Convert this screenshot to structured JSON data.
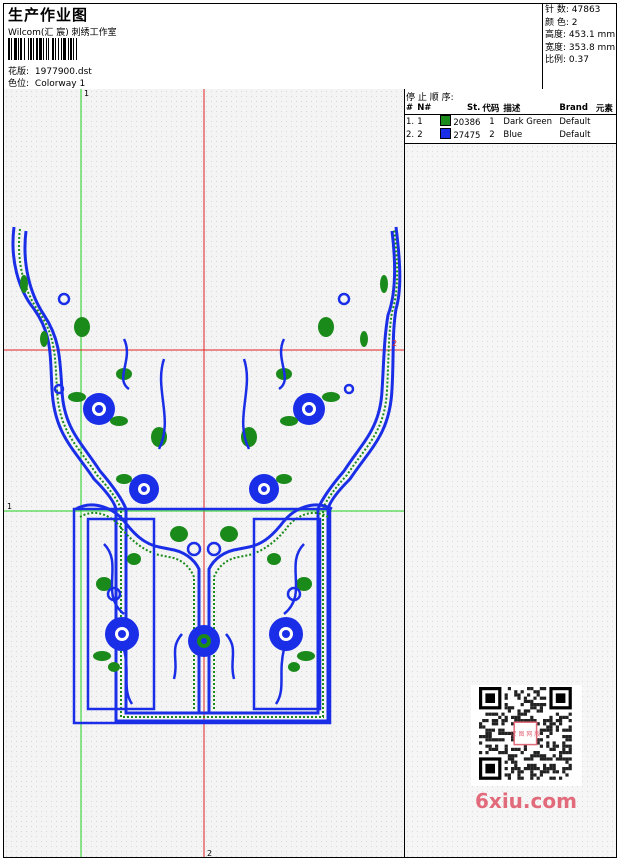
{
  "header": {
    "title": "生产作业图",
    "company": "Wilcom(汇 宸) 刺绣工作室",
    "design_label": "花版:",
    "design_value": "1977900.dst",
    "colorway_label": "色位:",
    "colorway_value": "Colorway 1"
  },
  "stats": [
    {
      "label": "针 数:",
      "value": "47863"
    },
    {
      "label": "颜 色:",
      "value": "2"
    },
    {
      "label": "高度:",
      "value": "453.1 mm"
    },
    {
      "label": "宽度:",
      "value": "353.8 mm"
    },
    {
      "label": "比例:",
      "value": "0.37"
    }
  ],
  "stop_sequence": {
    "title": "停 止 顺 序:",
    "columns": [
      "#",
      "N#",
      "St.",
      "代码",
      "描述",
      "Brand",
      "元素"
    ],
    "rows": [
      {
        "idx": "1.",
        "n": "1",
        "color": "#1a8a1a",
        "stitches": "20386",
        "code": "1",
        "desc": "Dark Green",
        "brand": "Default"
      },
      {
        "idx": "2.",
        "n": "2",
        "color": "#1a2ee8",
        "stitches": "27475",
        "code": "2",
        "desc": "Blue",
        "brand": "Default"
      }
    ]
  },
  "guides": {
    "v_green_label": "1",
    "h_red_label": "2",
    "h_green_label": "1",
    "v_red_label": "2"
  },
  "watermark": {
    "text": "6xiu.com",
    "stamp": "汉 图 网 版"
  },
  "colors": {
    "thread_blue": "#1a2ee8",
    "thread_green": "#1a8a1a",
    "guide_red": "#e02020",
    "guide_green": "#20d020"
  }
}
